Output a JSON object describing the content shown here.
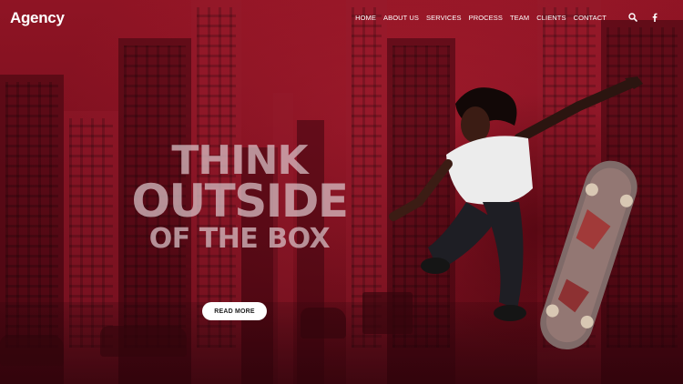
{
  "brand": {
    "name": "Agency"
  },
  "nav": {
    "items": [
      {
        "label": "HOME"
      },
      {
        "label": "ABOUT US"
      },
      {
        "label": "SERVICES"
      },
      {
        "label": "PROCESS"
      },
      {
        "label": "TEAM"
      },
      {
        "label": "CLIENTS"
      },
      {
        "label": "CONTACT"
      }
    ],
    "icons": [
      "search-icon",
      "facebook-icon"
    ]
  },
  "hero": {
    "line1": "THINK",
    "line2": "OUTSIDE",
    "line3": "OF THE BOX",
    "cta_label": "READ MORE"
  },
  "colors": {
    "overlay": "#7a0f1e",
    "headline": "#d7bec3",
    "button_bg": "#ffffff",
    "text_light": "#ffffff"
  }
}
